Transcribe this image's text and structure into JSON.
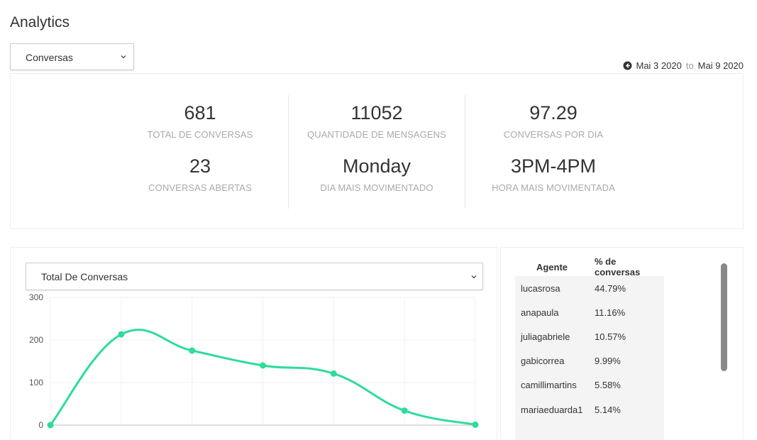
{
  "page": {
    "title": "Analytics"
  },
  "filter": {
    "selected": "Conversas"
  },
  "date_range": {
    "start": "Mai 3 2020",
    "separator": "to",
    "end": "Mai 9 2020"
  },
  "stats": [
    {
      "value": "681",
      "label": "TOTAL DE CONVERSAS"
    },
    {
      "value": "11052",
      "label": "QUANTIDADE DE MENSAGENS"
    },
    {
      "value": "97.29",
      "label": "CONVERSAS POR DIA"
    },
    {
      "value": "23",
      "label": "CONVERSAS ABERTAS"
    },
    {
      "value": "Monday",
      "label": "DIA MAIS MOVIMENTADO"
    },
    {
      "value": "3PM-4PM",
      "label": "HORA MAIS MOVIMENTADA"
    }
  ],
  "chart_select": {
    "selected": "Total De Conversas"
  },
  "chart_data": {
    "type": "line",
    "x": [
      0,
      1,
      2,
      3,
      4,
      5,
      6
    ],
    "values": [
      0,
      213,
      175,
      140,
      121,
      34,
      1
    ],
    "ylim": [
      0,
      300
    ],
    "yticks": [
      "300",
      "200",
      "100",
      "0"
    ],
    "color": "#2edc9a",
    "grid": true
  },
  "agents_table": {
    "headers": [
      "Agente",
      "% de conversas"
    ],
    "rows": [
      [
        "lucasrosa",
        "44.79%"
      ],
      [
        "anapaula",
        "11.16%"
      ],
      [
        "juliagabriele",
        "10.57%"
      ],
      [
        "gabicorrea",
        "9.99%"
      ],
      [
        "camillimartins",
        "5.58%"
      ],
      [
        "mariaeduarda1",
        "5.14%"
      ]
    ]
  },
  "colors": {
    "accent": "#2edc9a",
    "muted_text": "#aaaaaa",
    "scrollbar": "#888888"
  },
  "icons": {
    "select_chevron": "chevron-down-icon",
    "date_back": "arrow-circle-left-icon"
  }
}
